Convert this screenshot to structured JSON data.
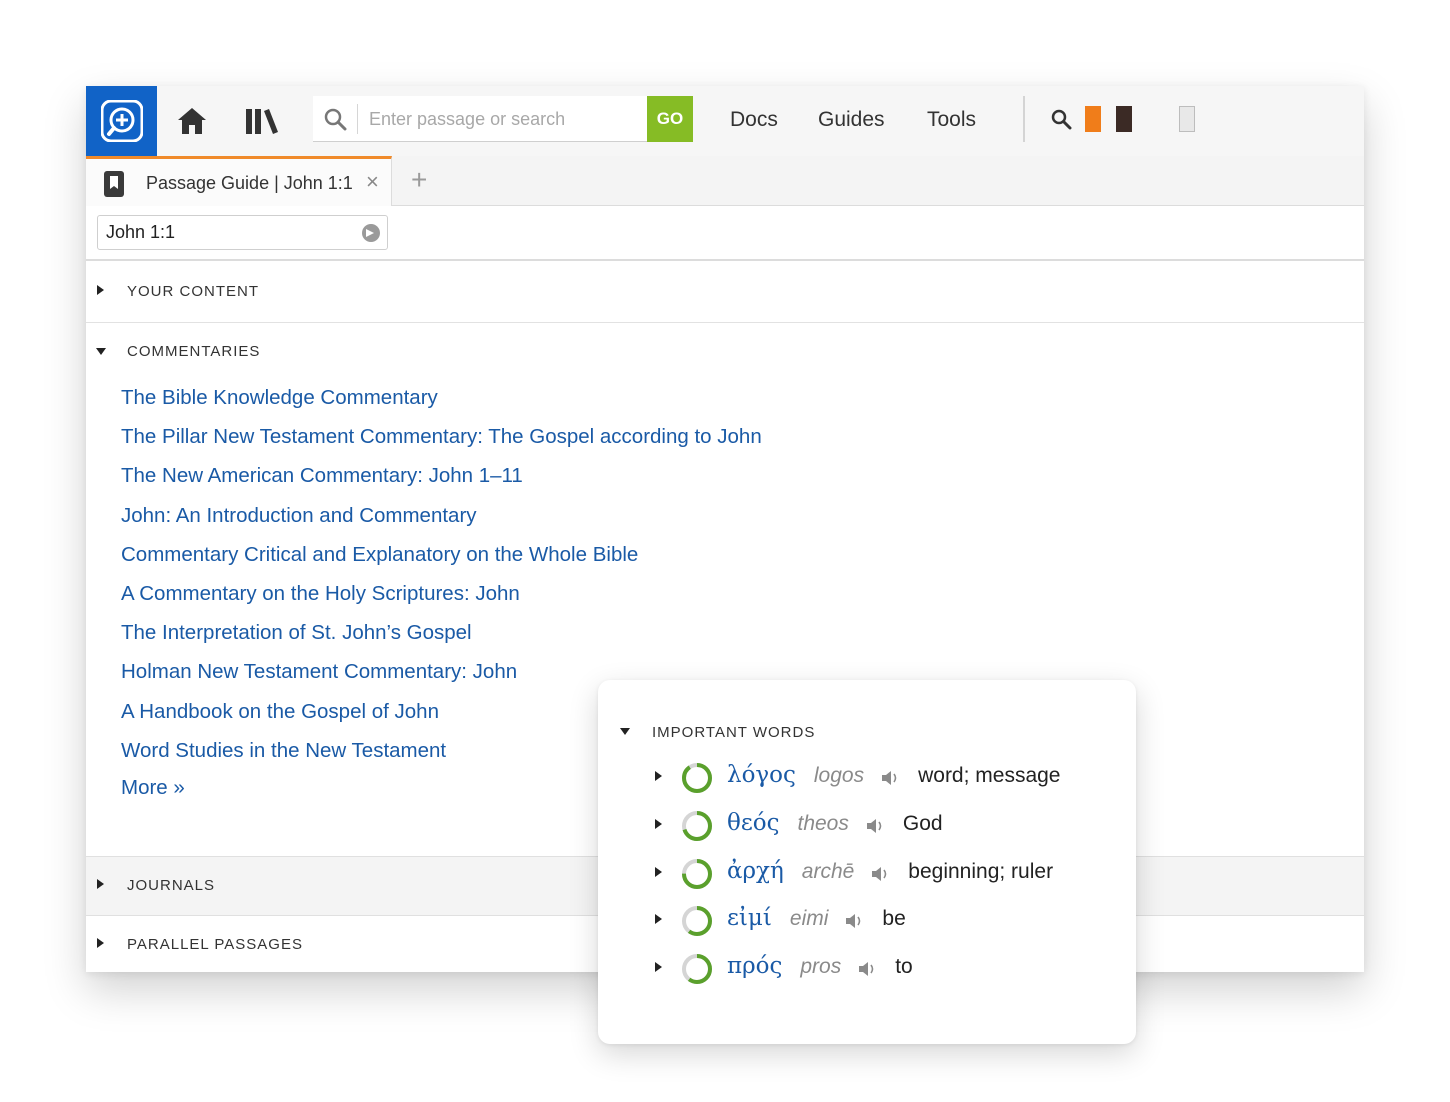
{
  "topbar": {
    "search_placeholder": "Enter passage or search",
    "go_label": "GO",
    "nav": {
      "docs": "Docs",
      "guides": "Guides",
      "tools": "Tools"
    }
  },
  "tab": {
    "title": "Passage Guide | John 1:1",
    "close": "×",
    "add": "+"
  },
  "passage": {
    "value": "John 1:1"
  },
  "sections": {
    "your_content": "YOUR CONTENT",
    "commentaries": "COMMENTARIES",
    "journals": "JOURNALS",
    "parallel": "PARALLEL PASSAGES"
  },
  "commentaries": [
    "The Bible Knowledge Commentary",
    "The Pillar New Testament Commentary: The Gospel according to John",
    "The New American Commentary: John 1–11",
    "John: An Introduction and Commentary",
    "Commentary Critical and Explanatory on the Whole Bible",
    "A Commentary on the Holy Scriptures: John",
    "The Interpretation of St. John’s Gospel",
    "Holman New Testament Commentary: John",
    "A Handbook on the Gospel of John",
    "Word Studies in the New Testament"
  ],
  "more_label": "More »",
  "important_words": {
    "label": "IMPORTANT WORDS",
    "words": [
      {
        "greek": "λόγος",
        "translit": "logos",
        "gloss": "word; message",
        "frequency": 0.9
      },
      {
        "greek": "θεός",
        "translit": "theos",
        "gloss": "God",
        "frequency": 0.7
      },
      {
        "greek": "ἀρχή",
        "translit": "archē",
        "gloss": "beginning; ruler",
        "frequency": 0.75
      },
      {
        "greek": "εἰμί",
        "translit": "eimi",
        "gloss": "be",
        "frequency": 0.6
      },
      {
        "greek": "πρός",
        "translit": "pros",
        "gloss": "to",
        "frequency": 0.6
      }
    ]
  },
  "colors": {
    "brand_blue": "#1163c7",
    "go_green": "#86bc25",
    "link_blue": "#1a5aa6",
    "tab_accent": "#f08a2a",
    "ring_green": "#5aa02c"
  }
}
